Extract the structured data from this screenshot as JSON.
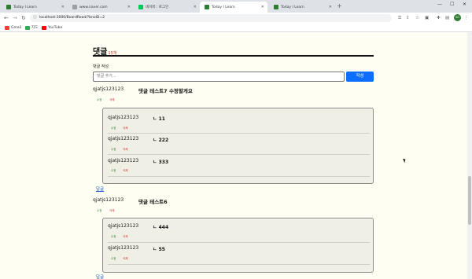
{
  "browser": {
    "tabs": [
      {
        "title": "Today I Learn",
        "color": "#2e7d32"
      },
      {
        "title": "www.naver.com",
        "color": "#9e9e9e"
      },
      {
        "title": "네이버 : 로그인",
        "color": "#03c75a"
      },
      {
        "title": "Today I Learn",
        "color": "#2e7d32"
      },
      {
        "title": "Today I Learn",
        "color": "#2e7d32"
      }
    ],
    "new_tab_icon": "+",
    "url": "localhost:3000/BoardRead/?bnoID=2",
    "bookmarks": [
      {
        "label": "Gmail",
        "icon": "gmail-icon",
        "color": "#ea4335"
      },
      {
        "label": "지도",
        "icon": "maps-icon",
        "color": "#34a853"
      },
      {
        "label": "YouTube",
        "icon": "youtube-icon",
        "color": "#ff0000"
      }
    ],
    "profile_initials": "SG"
  },
  "comments_section": {
    "title": "댓글",
    "count_text": "15개",
    "write_label": "댓글 작성",
    "input_placeholder": "댓글 추가...",
    "submit_label": "작성",
    "edit_label": "수정",
    "delete_label": "삭제",
    "reply_label": "답글"
  },
  "comments": [
    {
      "author": "qjatjs123123",
      "text": "댓글 테스트7 수정할게요",
      "replies": [
        {
          "author": "qjatjs123123",
          "text": "ㄴ 11"
        },
        {
          "author": "qjatjs123123",
          "text": "ㄴ 222"
        },
        {
          "author": "qjatjs123123",
          "text": "ㄴ 333"
        }
      ]
    },
    {
      "author": "qjatjs123123",
      "text": "댓글 테스트6",
      "replies": [
        {
          "author": "qjatjs123123",
          "text": "ㄴ 444"
        },
        {
          "author": "qjatjs123123",
          "text": "ㄴ 55"
        }
      ]
    }
  ]
}
